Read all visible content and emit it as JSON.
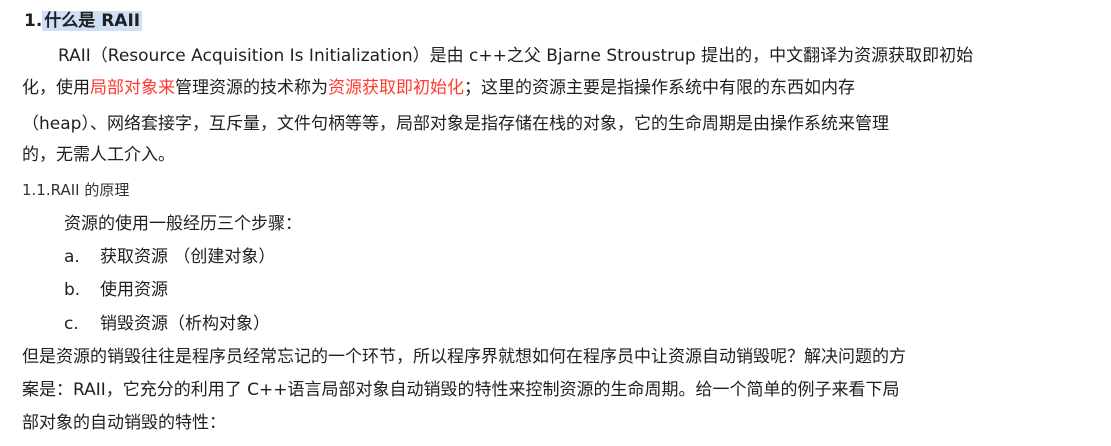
{
  "section": {
    "number": "1.",
    "title": "什么是 RAII"
  },
  "intro": {
    "line1": "RAII（Resource Acquisition Is Initialization）是由 c++之父 Bjarne Stroustrup 提出的，中文翻译为资源获取即初始",
    "line2_a": "化，使用",
    "line2_red1": "局部对象来",
    "line2_b": "管理资源的技术称为",
    "line2_red2": "资源获取即初始化",
    "line2_c": "；这里的资源主要是指操作系统中有限的东西如内存",
    "line3": "（heap）、网络套接字，互斥量，文件句柄等等，局部对象是指存储在栈的对象，它的生命周期是由操作系统来管理",
    "line4": "的，无需人工介入。"
  },
  "subsection": {
    "title": "1.1.RAII 的原理"
  },
  "steps": {
    "intro": "资源的使用一般经历三个步骤：",
    "items": [
      {
        "marker": "a.",
        "text": "获取资源 （创建对象）"
      },
      {
        "marker": "b.",
        "text": "使用资源"
      },
      {
        "marker": "c.",
        "text": "销毁资源（析构对象）"
      }
    ]
  },
  "conclusion": {
    "line1": "但是资源的销毁往往是程序员经常忘记的一个环节，所以程序界就想如何在程序员中让资源自动销毁呢？解决问题的方",
    "line2": "案是：RAII，它充分的利用了 C++语言局部对象自动销毁的特性来控制资源的生命周期。给一个简单的例子来看下局",
    "line3": "部对象的自动销毁的特性："
  },
  "colors": {
    "text": "#1f1f1f",
    "emphasis": "#ff3b2f",
    "highlight": "#cfe0f5"
  }
}
